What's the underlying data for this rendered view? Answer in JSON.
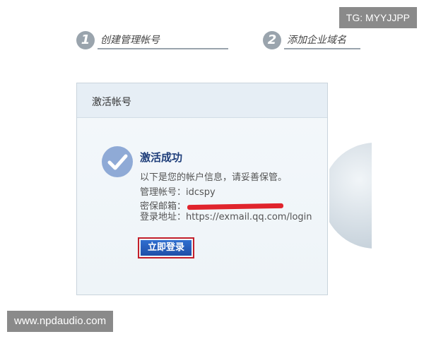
{
  "watermarks": {
    "top": "TG: MYYJJPP",
    "bottom": "www.npdaudio.com"
  },
  "steps": [
    {
      "number": "1",
      "label": "创建管理帐号"
    },
    {
      "number": "2",
      "label": "添加企业域名"
    }
  ],
  "card": {
    "title": "激活帐号",
    "success_title": "激活成功",
    "intro": "以下是您的帐户信息，请妥善保管。",
    "account_label": "管理帐号：",
    "account_value": "idcspy",
    "email_label": "密保邮箱：",
    "login_label": "登录地址：",
    "login_url": "https://exmail.qq.com/login",
    "login_button": "立即登录"
  },
  "colors": {
    "accent": "#1f4fa8",
    "highlight_border": "#c31f2b",
    "redaction": "#e0242c"
  }
}
